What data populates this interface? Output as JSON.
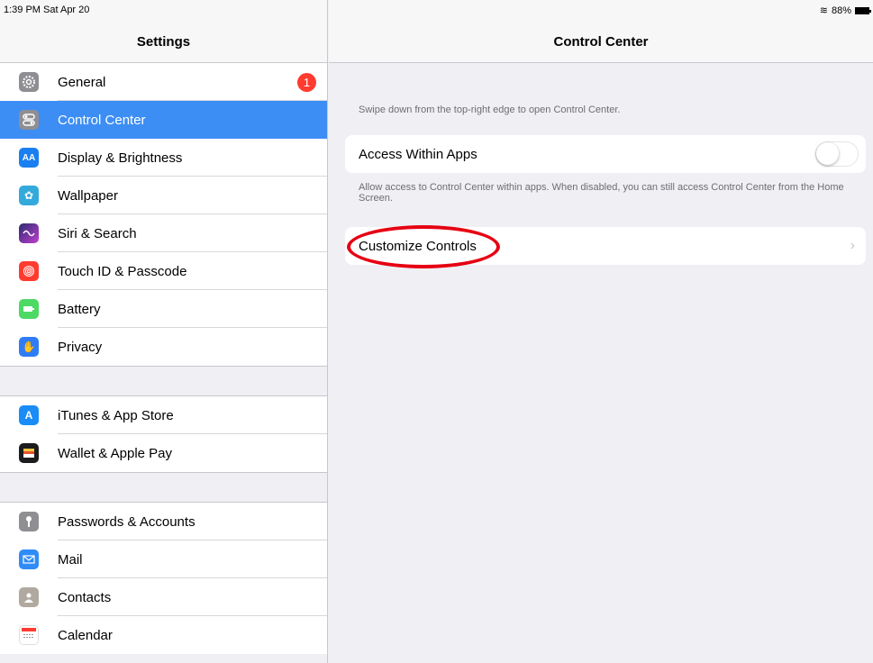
{
  "status": {
    "time": "1:39 PM  Sat Apr 20",
    "wifi": "wifi-icon",
    "battery": "88%"
  },
  "left": {
    "title": "Settings",
    "groups": [
      [
        {
          "label": "General",
          "icon": "gear-icon",
          "color": "#8e8e93",
          "badge": "1"
        },
        {
          "label": "Control Center",
          "icon": "switches-icon",
          "color": "#8e8e93",
          "selected": true
        },
        {
          "label": "Display & Brightness",
          "icon": "text-size-icon",
          "color": "#1a7ff0"
        },
        {
          "label": "Wallpaper",
          "icon": "flower-icon",
          "color": "#34aadc"
        },
        {
          "label": "Siri & Search",
          "icon": "siri-icon",
          "color": "#1c1c1e"
        },
        {
          "label": "Touch ID & Passcode",
          "icon": "fingerprint-icon",
          "color": "#ff3b30"
        },
        {
          "label": "Battery",
          "icon": "battery-icon",
          "color": "#4cd964"
        },
        {
          "label": "Privacy",
          "icon": "hand-icon",
          "color": "#2f7cf6"
        }
      ],
      [
        {
          "label": "iTunes & App Store",
          "icon": "app-store-icon",
          "color": "#1a8cf7"
        },
        {
          "label": "Wallet & Apple Pay",
          "icon": "wallet-icon",
          "color": "#1c1c1e"
        }
      ],
      [
        {
          "label": "Passwords & Accounts",
          "icon": "key-icon",
          "color": "#8e8e93"
        },
        {
          "label": "Mail",
          "icon": "mail-icon",
          "color": "#2f8cf7"
        },
        {
          "label": "Contacts",
          "icon": "contacts-icon",
          "color": "#b0a99f"
        },
        {
          "label": "Calendar",
          "icon": "calendar-icon",
          "color": "#ffffff"
        }
      ]
    ]
  },
  "right": {
    "title": "Control Center",
    "hint_top": "Swipe down from the top-right edge to open Control Center.",
    "access_label": "Access Within Apps",
    "access_enabled": false,
    "hint_access": "Allow access to Control Center within apps. When disabled, you can still access Control Center from the Home Screen.",
    "customize_label": "Customize Controls"
  },
  "colors": {
    "selected": "#3d8ef4",
    "badge": "#ff3b30",
    "annotation": "#e60012"
  }
}
